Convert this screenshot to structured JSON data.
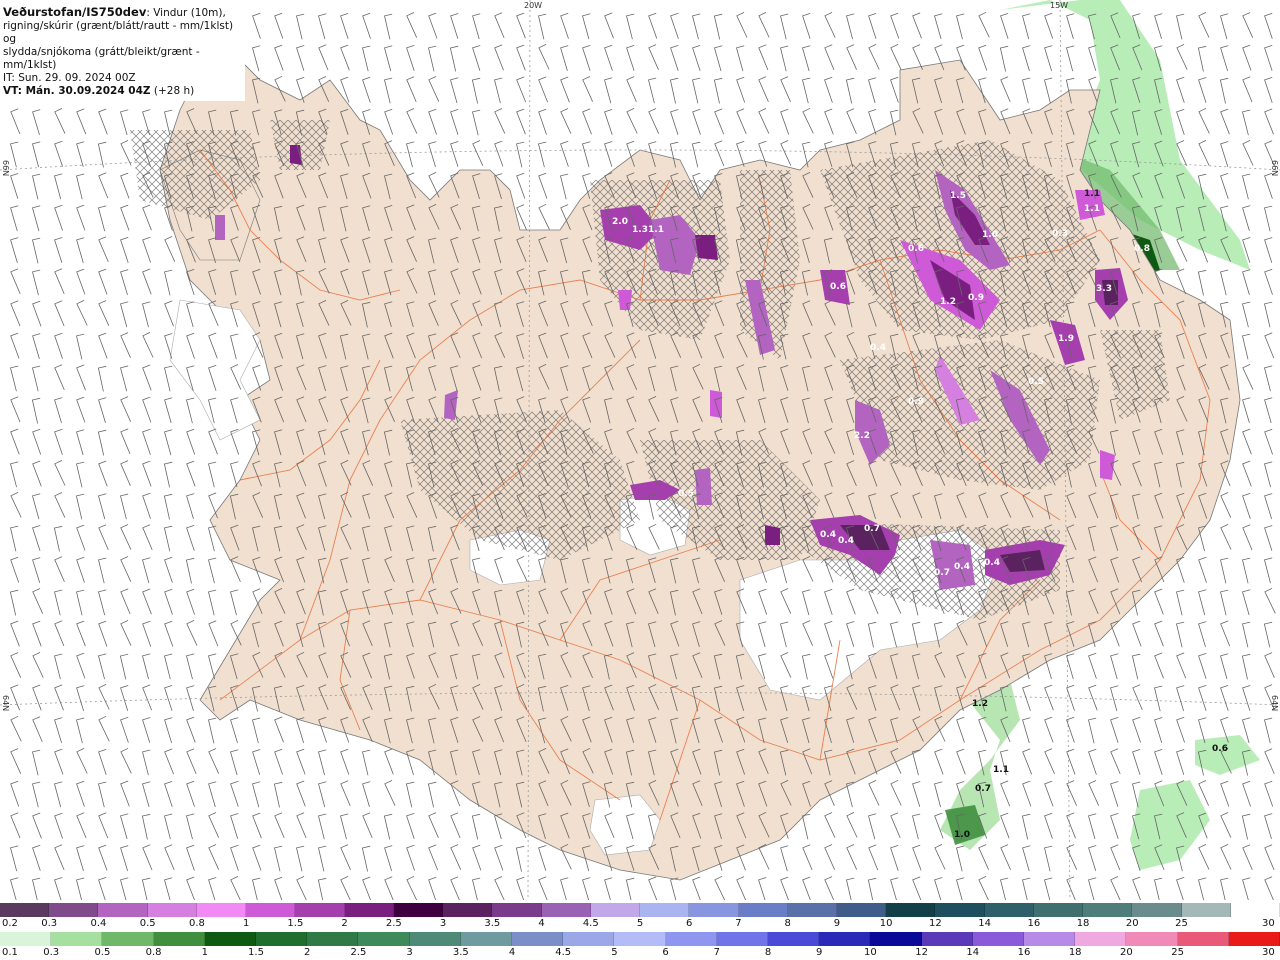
{
  "header": {
    "brand": "Veðurstofan/IS750dev",
    "desc_1": ": Vindur (10m),",
    "desc_2": "rigning/skúrir (grænt/blátt/rautt - mm/1klst) og",
    "desc_3": "slydda/snjókoma (grátt/bleikt/grænt - mm/1klst)",
    "it": "IT: Sun. 29. 09. 2024 00Z",
    "vt": "VT: Mán. 30.09.2024 04Z",
    "lead": "(+28 h)"
  },
  "grid_labels": {
    "lon_20w": "20W",
    "lon_15w": "15W",
    "lat_66n_left": "66N",
    "lat_66n_right": "66N",
    "lat_64n_left": "64N",
    "lat_64n_right": "64N"
  },
  "precip_labels": [
    {
      "text": "2.0",
      "tone": "snow"
    },
    {
      "text": "1.3",
      "tone": "snow"
    },
    {
      "text": "1.1",
      "tone": "snow"
    },
    {
      "text": "1.5",
      "tone": "snow"
    },
    {
      "text": "1.0",
      "tone": "snow"
    },
    {
      "text": "0.6",
      "tone": "snow"
    },
    {
      "text": "1.2",
      "tone": "snow"
    },
    {
      "text": "0.9",
      "tone": "snow"
    },
    {
      "text": "0.6",
      "tone": "snow"
    },
    {
      "text": "0.4",
      "tone": "snow"
    },
    {
      "text": "0.9",
      "tone": "snow"
    },
    {
      "text": "1.1",
      "tone": "snow"
    },
    {
      "text": "3.3",
      "tone": "snow"
    },
    {
      "text": "1.9",
      "tone": "snow"
    },
    {
      "text": "0.3",
      "tone": "snow"
    },
    {
      "text": "0.7",
      "tone": "snow"
    },
    {
      "text": "0.4",
      "tone": "snow"
    },
    {
      "text": "0.5",
      "tone": "snow"
    },
    {
      "text": "0.4",
      "tone": "snow"
    },
    {
      "text": "0.7",
      "tone": "snow"
    },
    {
      "text": "0.4",
      "tone": "snow"
    },
    {
      "text": "0.4",
      "tone": "snow"
    },
    {
      "text": "2.2",
      "tone": "snow"
    },
    {
      "text": "0.5",
      "tone": "snow"
    },
    {
      "text": "1.1",
      "tone": "snow"
    },
    {
      "text": "0.8",
      "tone": "snow"
    },
    {
      "text": "1.2",
      "tone": "rain"
    },
    {
      "text": "1.1",
      "tone": "rain"
    },
    {
      "text": "0.7",
      "tone": "rain"
    },
    {
      "text": "1.0",
      "tone": "rain"
    },
    {
      "text": "0.6",
      "tone": "rain"
    }
  ],
  "legend": {
    "snow_scale": [
      "0.2",
      "0.3",
      "0.4",
      "0.5",
      "0.8",
      "1",
      "1.5",
      "2",
      "2.5",
      "3",
      "3.5",
      "4",
      "4.5",
      "5",
      "6",
      "7",
      "8",
      "9",
      "10",
      "12",
      "14",
      "16",
      "18",
      "20",
      "25",
      "30"
    ],
    "snow_colors": [
      "#5a3a5e",
      "#7f4b8a",
      "#b264c0",
      "#d57fe0",
      "#f28af5",
      "#cf5ad8",
      "#a53fae",
      "#7a1f80",
      "#3f0040",
      "#5a2360",
      "#7a3c8a",
      "#9a62b4",
      "#c2a8e8",
      "#aab4f0",
      "#8896e0",
      "#6a7ec8",
      "#5a70a8",
      "#3f5c8a",
      "#123f48",
      "#1f4f5e",
      "#2f5f6a",
      "#3f706f",
      "#4f7e7a",
      "#6a8c8c",
      "#a4b8b8",
      "#ffffff"
    ],
    "rain_scale": [
      "0.1",
      "0.3",
      "0.5",
      "0.8",
      "1",
      "1.5",
      "2",
      "2.5",
      "3",
      "3.5",
      "4",
      "4.5",
      "5",
      "6",
      "7",
      "8",
      "9",
      "10",
      "12",
      "14",
      "16",
      "18",
      "20",
      "25",
      "30"
    ],
    "rain_colors": [
      "#d9f5d9",
      "#a6e0a0",
      "#6fb86a",
      "#3f8f3f",
      "#0e5a12",
      "#1f6e2e",
      "#2f7a45",
      "#3f8a5a",
      "#4f8a78",
      "#6f9aa0",
      "#7a8ec8",
      "#9aa8e8",
      "#b4bcf8",
      "#8f96f0",
      "#6f74e8",
      "#4a4ad8",
      "#2a2ab8",
      "#0a0a98",
      "#5a3ab8",
      "#8a5ad8",
      "#b88ae8",
      "#f0a8e0",
      "#f08ab8",
      "#e85a78",
      "#e81a1a"
    ]
  }
}
